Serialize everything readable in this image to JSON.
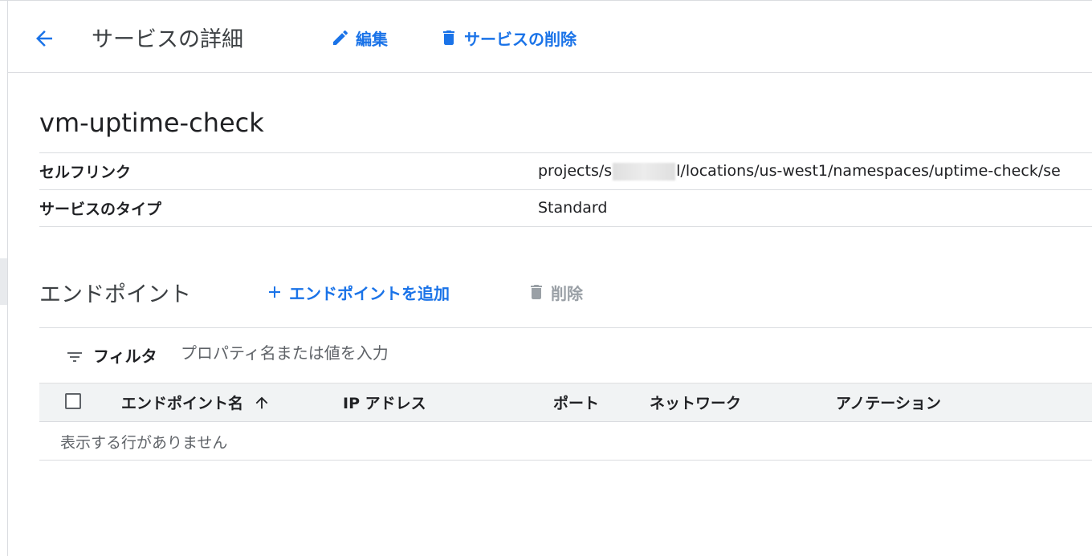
{
  "colors": {
    "accent": "#1a73e8",
    "disabled": "#9aa0a6",
    "border": "#dadce0",
    "header_bg": "#f1f3f4"
  },
  "header": {
    "back_icon": "arrow-back-icon",
    "title": "サービスの詳細",
    "edit_label": "編集",
    "edit_icon": "pencil-icon",
    "delete_label": "サービスの削除",
    "delete_icon": "trash-icon"
  },
  "service": {
    "name": "vm-uptime-check",
    "properties": [
      {
        "key": "セルフリンク",
        "value_prefix": "projects/s",
        "value_suffix": "l/locations/us-west1/namespaces/uptime-check/se"
      },
      {
        "key": "サービスのタイプ",
        "value": "Standard"
      }
    ]
  },
  "endpoints": {
    "title": "エンドポイント",
    "add_label": "エンドポイントを追加",
    "add_icon": "plus-icon",
    "delete_label": "削除",
    "delete_icon": "trash-icon",
    "filter": {
      "icon": "filter-icon",
      "label": "フィルタ",
      "placeholder": "プロパティ名または値を入力",
      "value": ""
    },
    "columns": [
      "エンドポイント名",
      "IP アドレス",
      "ポート",
      "ネットワーク",
      "アノテーション"
    ],
    "sort_icon": "arrow-up-icon",
    "sort": "ascending",
    "empty_message": "表示する行がありません"
  }
}
